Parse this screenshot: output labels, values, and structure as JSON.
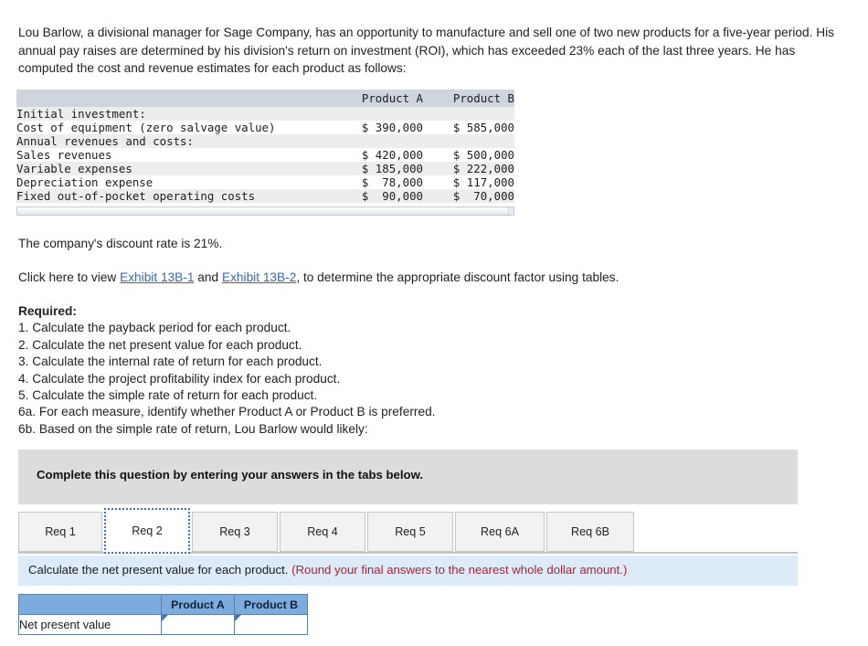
{
  "problem": {
    "intro": "Lou Barlow, a divisional manager for Sage Company, has an opportunity to manufacture and sell one of two new products for a five-year period. His annual pay raises are determined by his division's return on investment (ROI), which has exceeded 23% each of the last three years. He has computed the cost and revenue estimates for each product as follows:",
    "discount_line": "The company's discount rate is 21%.",
    "exhibit_prefix": "Click here to view ",
    "exhibit_link_1": "Exhibit 13B-1",
    "exhibit_conjunction": " and ",
    "exhibit_link_2": "Exhibit 13B-2",
    "exhibit_suffix": ", to determine the appropriate discount factor using tables."
  },
  "data_table": {
    "headers": [
      "",
      "Product A",
      "Product B"
    ],
    "rows": [
      {
        "label": "Initial investment:",
        "a": "",
        "b": "",
        "shaded": true
      },
      {
        "label": "Cost of equipment (zero salvage value)",
        "a": "$ 390,000",
        "b": "$ 585,000",
        "shaded": false
      },
      {
        "label": "Annual revenues and costs:",
        "a": "",
        "b": "",
        "shaded": true
      },
      {
        "label": "Sales revenues",
        "a": "$ 420,000",
        "b": "$ 500,000",
        "shaded": false
      },
      {
        "label": "Variable expenses",
        "a": "$ 185,000",
        "b": "$ 222,000",
        "shaded": true
      },
      {
        "label": "Depreciation expense",
        "a": "$  78,000",
        "b": "$ 117,000",
        "shaded": false
      },
      {
        "label": "Fixed out-of-pocket operating costs",
        "a": "$  90,000",
        "b": "$  70,000",
        "shaded": true
      }
    ]
  },
  "required": {
    "heading": "Required:",
    "items": [
      "1. Calculate the payback period for each product.",
      "2. Calculate the net present value for each product.",
      "3. Calculate the internal rate of return for each product.",
      "4. Calculate the project profitability index for each product.",
      "5. Calculate the simple rate of return for each product.",
      "6a. For each measure, identify whether Product A or Product B is preferred.",
      "6b. Based on the simple rate of return, Lou Barlow would likely:"
    ]
  },
  "banner": {
    "text": "Complete this question by entering your answers in the tabs below."
  },
  "tabs": [
    {
      "label": "Req 1",
      "active": false
    },
    {
      "label": "Req 2",
      "active": true
    },
    {
      "label": "Req 3",
      "active": false
    },
    {
      "label": "Req 4",
      "active": false
    },
    {
      "label": "Req 5",
      "active": false
    },
    {
      "label": "Req 6A",
      "active": false
    },
    {
      "label": "Req 6B",
      "active": false
    }
  ],
  "question_bar": {
    "prompt": "Calculate the net present value for each product. ",
    "note": "(Round your final answers to the nearest whole dollar amount.)"
  },
  "answer_table": {
    "corner": "",
    "col_a": "Product A",
    "col_b": "Product B",
    "row_label": "Net present value",
    "value_a": "",
    "value_b": "",
    "placeholder": ""
  },
  "colors": {
    "link": "#3767ad",
    "note_red": "#b0222f",
    "table_header": "#ced5dd",
    "answer_header": "#7cacdd",
    "banner_gray": "#dcdcdc",
    "question_blue": "#ddeaf7",
    "tab_focus": "#3b72c4"
  }
}
